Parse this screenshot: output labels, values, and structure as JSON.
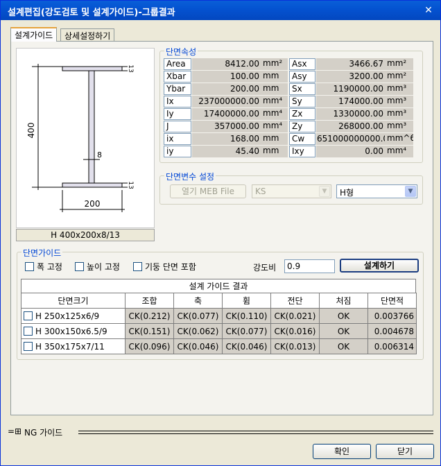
{
  "window": {
    "title": "설계편집(강도검토 및 설계가이드)-그룹결과",
    "close_glyph": "✕"
  },
  "tabs": [
    {
      "label": "설계가이드"
    },
    {
      "label": "상세설정하기"
    }
  ],
  "drawing": {
    "dim_height": "400",
    "dim_width": "200",
    "dim_web": "8",
    "dim_flange_top": "13",
    "dim_flange_bottom": "13",
    "caption": "H 400x200x8/13"
  },
  "properties": {
    "legend": "단면속성",
    "rows": [
      {
        "l1": "Area",
        "v1": "8412.00",
        "u1": "mm²",
        "l2": "Asx",
        "v2": "3466.67",
        "u2": "mm²"
      },
      {
        "l1": "Xbar",
        "v1": "100.00",
        "u1": "mm",
        "l2": "Asy",
        "v2": "3200.00",
        "u2": "mm²"
      },
      {
        "l1": "Ybar",
        "v1": "200.00",
        "u1": "mm",
        "l2": "Sx",
        "v2": "1190000.00",
        "u2": "mm³"
      },
      {
        "l1": "Ix",
        "v1": "237000000.00",
        "u1": "mm⁴",
        "l2": "Sy",
        "v2": "174000.00",
        "u2": "mm³"
      },
      {
        "l1": "Iy",
        "v1": "17400000.00",
        "u1": "mm⁴",
        "l2": "Zx",
        "v2": "1330000.00",
        "u2": "mm³"
      },
      {
        "l1": "J",
        "v1": "357000.00",
        "u1": "mm⁴",
        "l2": "Zy",
        "v2": "268000.00",
        "u2": "mm³"
      },
      {
        "l1": "ix",
        "v1": "168.00",
        "u1": "mm",
        "l2": "Cw",
        "v2": "651000000000.00",
        "u2": "mm^6"
      },
      {
        "l1": "iy",
        "v1": "45.40",
        "u1": "mm",
        "l2": "Ixy",
        "v2": "0.00",
        "u2": "mm⁴"
      }
    ]
  },
  "section_vars": {
    "legend": "단면변수 설정",
    "open_button": "열기 MEB File",
    "db_combo": "KS",
    "shape_combo": "H형"
  },
  "guide": {
    "legend": "단면가이드",
    "check_width": "폭 고정",
    "check_height": "높이 고정",
    "check_column": "기둥 단면 포함",
    "strength_label": "강도비",
    "strength_value": "0.9",
    "design_button": "설계하기",
    "result_title": "설계 가이드 결과",
    "columns": [
      "단면크기",
      "조합",
      "축",
      "휨",
      "전단",
      "처짐",
      "단면적"
    ],
    "rows": [
      {
        "name": "H 250x125x6/9",
        "combo": "CK(0.212)",
        "axial": "CK(0.077)",
        "bend": "CK(0.110)",
        "shear": "CK(0.021)",
        "defl": "OK",
        "area": "0.003766"
      },
      {
        "name": "H 300x150x6.5/9",
        "combo": "CK(0.151)",
        "axial": "CK(0.062)",
        "bend": "CK(0.077)",
        "shear": "CK(0.016)",
        "defl": "OK",
        "area": "0.004678"
      },
      {
        "name": "H 350x175x7/11",
        "combo": "CK(0.096)",
        "axial": "CK(0.046)",
        "bend": "CK(0.046)",
        "shear": "CK(0.013)",
        "defl": "OK",
        "area": "0.006314"
      }
    ]
  },
  "footer": {
    "ng_guide_label": "NG 가이드",
    "expand_glyph": "=⊞",
    "ok_button": "확인",
    "close_button": "닫기"
  },
  "colors": {
    "title_bar": "#0453d1",
    "legend_text": "#0046d5",
    "tab_highlight": "#e6a33b"
  }
}
